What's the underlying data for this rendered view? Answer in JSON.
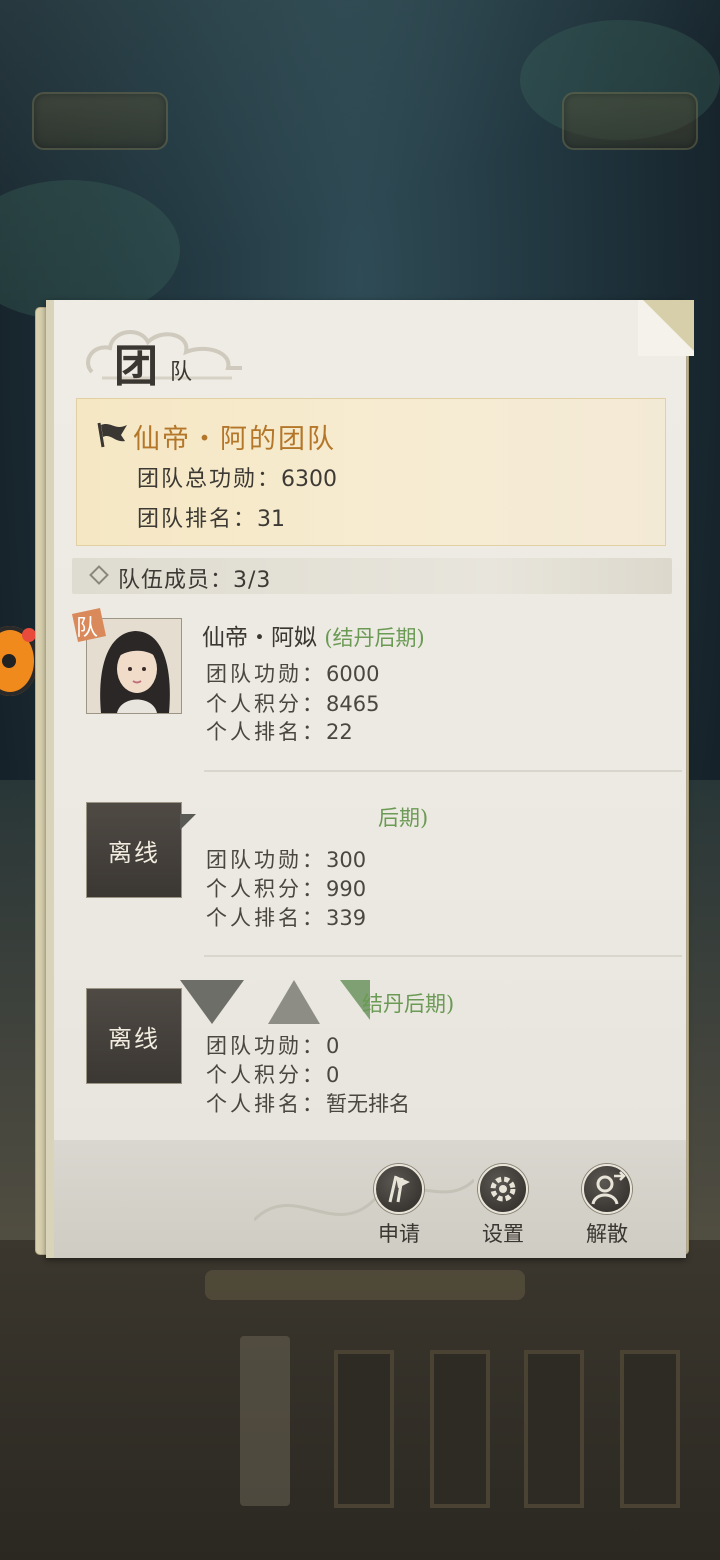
{
  "panel": {
    "title_char": "团",
    "title_small": "队"
  },
  "team": {
    "name": "仙帝・阿的团队",
    "merit_label": "团队总功勋：",
    "merit_value": "6300",
    "rank_label": "团队排名：",
    "rank_value": "31"
  },
  "members_header": {
    "label": "队伍成员：",
    "count": "3/3"
  },
  "members": [
    {
      "status": "online",
      "leader_tag": "队",
      "name": "仙帝・阿姒",
      "realm": "(结丹后期)",
      "merit_label": "团队功勋：",
      "merit": "6000",
      "points_label": "个人积分：",
      "points": "8465",
      "rank_label": "个人排名：",
      "rank": "22"
    },
    {
      "status": "offline",
      "offline_label": "离线",
      "name": "",
      "realm": "后期)",
      "merit_label": "团队功勋：",
      "merit": "300",
      "points_label": "个人积分：",
      "points": "990",
      "rank_label": "个人排名：",
      "rank": "339"
    },
    {
      "status": "offline",
      "offline_label": "离线",
      "name": "",
      "realm": "结丹后期)",
      "merit_label": "团队功勋：",
      "merit": "0",
      "points_label": "个人积分：",
      "points": "0",
      "rank_label": "个人排名：",
      "rank": "暂无排名"
    }
  ],
  "footer": {
    "apply_label": "申请",
    "settings_label": "设置",
    "disband_label": "解散"
  },
  "colors": {
    "team_name": "#b4772a",
    "realm": "#6b9a55",
    "panel": "#eeece4"
  }
}
